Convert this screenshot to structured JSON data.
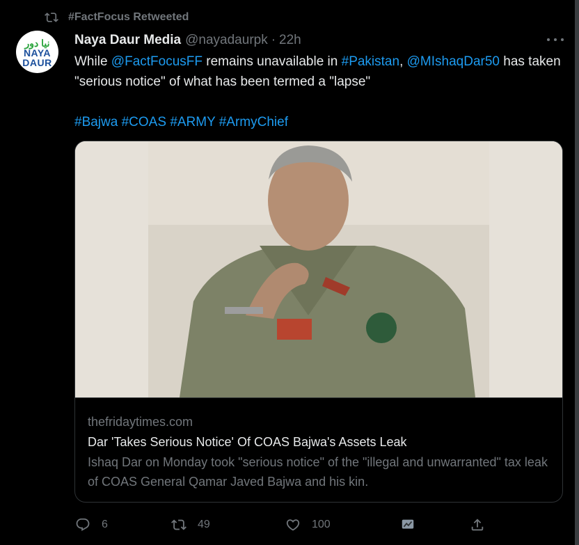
{
  "retweet_banner": {
    "text": "#FactFocus Retweeted"
  },
  "avatar": {
    "line1": "نیا دور",
    "line2": "NAYA",
    "line3": "DAUR"
  },
  "author": {
    "name": "Naya Daur Media",
    "handle": "@nayadaurpk",
    "separator": "·",
    "time": "22h"
  },
  "tweet": {
    "t1": "While ",
    "m1": "@FactFocusFF",
    "t2": " remains unavailable in ",
    "m2": "#Pakistan",
    "t3": ", ",
    "m3": "@MIshaqDar50",
    "t4": " has taken \"serious notice\" of what has been termed a \"lapse\"",
    "h1": "#Bajwa",
    "h2": "#COAS",
    "h3": "#ARMY",
    "h4": "#ArmyChief"
  },
  "card": {
    "domain": "thefridaytimes.com",
    "title": "Dar 'Takes Serious Notice' Of COAS Bajwa's Assets Leak",
    "description": "Ishaq Dar on Monday took \"serious notice\" of the \"illegal and unwarranted\" tax leak of COAS General Qamar Javed Bajwa and his kin."
  },
  "actions": {
    "replies": "6",
    "retweets": "49",
    "likes": "100"
  },
  "colors": {
    "background": "#000000",
    "text": "#e7e9ea",
    "muted": "#71767b",
    "link": "#1d9bf0",
    "border": "#2f3336"
  },
  "icons": [
    "retweet-icon",
    "more-icon",
    "reply-icon",
    "like-icon",
    "analytics-icon",
    "share-icon"
  ]
}
